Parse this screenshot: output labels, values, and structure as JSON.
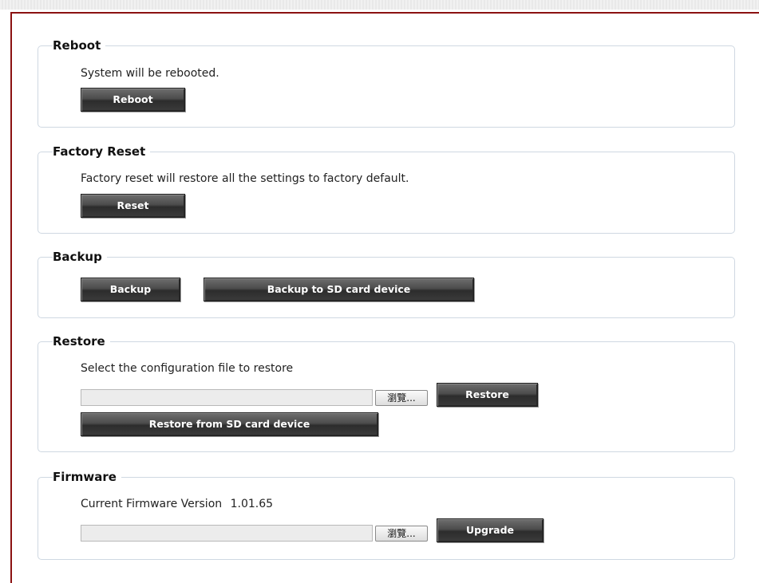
{
  "reboot": {
    "legend": "Reboot",
    "description": "System will be rebooted.",
    "button_label": "Reboot"
  },
  "factory_reset": {
    "legend": "Factory Reset",
    "description": "Factory reset will restore all the settings to factory default.",
    "button_label": "Reset"
  },
  "backup": {
    "legend": "Backup",
    "backup_label": "Backup",
    "backup_sd_label": "Backup to SD card device"
  },
  "restore": {
    "legend": "Restore",
    "description": "Select the configuration file to restore",
    "file_value": "",
    "browse_label": "瀏覽...",
    "restore_label": "Restore",
    "restore_sd_label": "Restore from SD card device"
  },
  "firmware": {
    "legend": "Firmware",
    "version_label": "Current Firmware Version",
    "version_value": "1.01.65",
    "file_value": "",
    "browse_label": "瀏覽...",
    "upgrade_label": "Upgrade"
  },
  "colors": {
    "frame_border": "#8b1111",
    "section_border": "#cfd8e2",
    "button_dark": "#3b3b3b"
  }
}
